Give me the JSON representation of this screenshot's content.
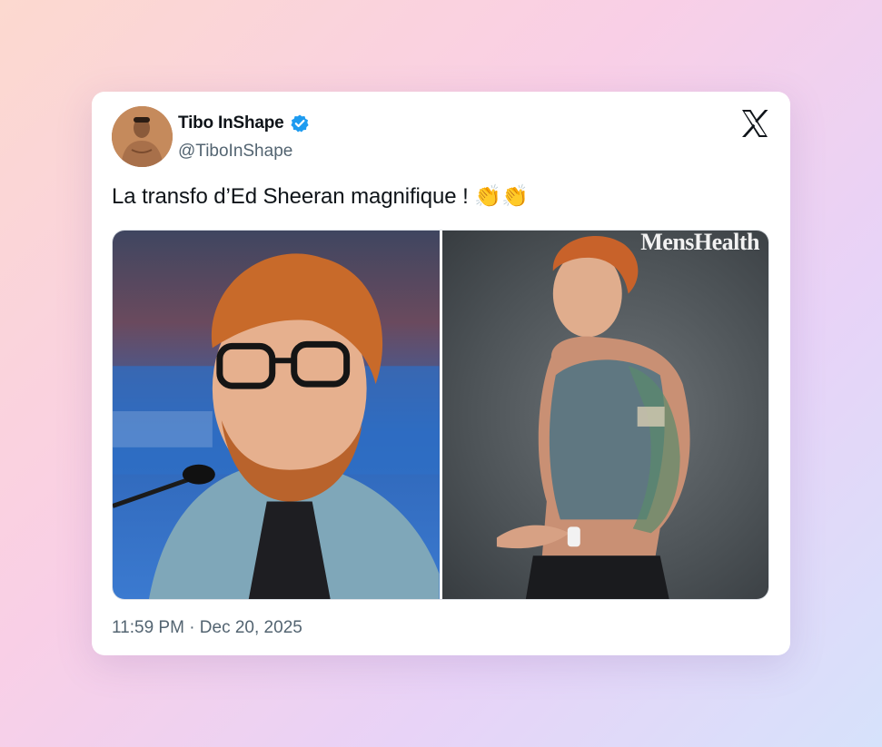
{
  "author": {
    "display_name": "Tibo InShape",
    "handle": "@TiboInShape",
    "verified": true
  },
  "tweet": {
    "text": "La transfo d’Ed Sheeran magnifique ! 👏👏",
    "timestamp": "11:59 PM · Dec 20, 2025"
  },
  "media": {
    "right_photo_magazine": "MensHealth"
  },
  "icons": {
    "platform": "x-logo-icon",
    "verified": "verified-badge-icon"
  },
  "colors": {
    "verified_blue": "#1d9bf0",
    "text_primary": "#0f1419",
    "text_secondary": "#536471"
  }
}
